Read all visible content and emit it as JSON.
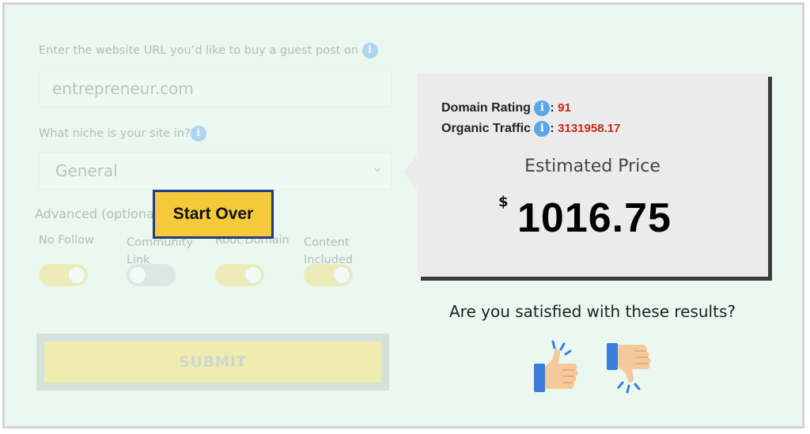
{
  "form": {
    "url_label": "Enter the website URL you’d like to buy a guest post on",
    "url_value": "entrepreneur.com",
    "niche_label": "What niche is your site in?",
    "niche_selected": "General",
    "advanced_label": "Advanced (optional)",
    "toggles": [
      {
        "label": "No Follow",
        "on": true
      },
      {
        "label": "Community Link",
        "on": false
      },
      {
        "label": "Root Domain",
        "on": true
      },
      {
        "label": "Content Included",
        "on": true
      }
    ],
    "submit_label": "SUBMIT",
    "start_over_label": "Start Over"
  },
  "results": {
    "domain_rating_label": "Domain Rating",
    "domain_rating_value": "91",
    "organic_traffic_label": "Organic Traffic",
    "organic_traffic_value": "3131958.17",
    "colon": ":",
    "estimated_price_label": "Estimated Price",
    "currency": "$",
    "price": "1016.75",
    "question": "Are you satisfied with these results?"
  },
  "icons": {
    "info": "i",
    "select_chevron": "⌄"
  },
  "colors": {
    "accent_yellow": "#f4c93a",
    "start_over_border": "#1f3c7c",
    "metric_value": "#d0241a",
    "thumb_blue": "#3b7ddd",
    "thumb_skin": "#f6c99a"
  }
}
